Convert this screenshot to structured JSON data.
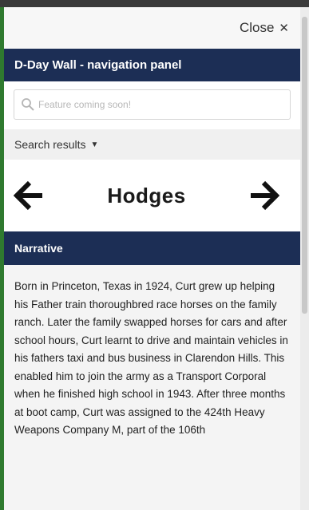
{
  "close": {
    "label": "Close",
    "icon": "close-icon"
  },
  "panel": {
    "title": "D-Day Wall - navigation panel"
  },
  "search": {
    "placeholder": "Feature coming soon!",
    "value": ""
  },
  "results": {
    "label": "Search results"
  },
  "navigation": {
    "name": "Hodges",
    "prev_icon": "arrow-left-icon",
    "next_icon": "arrow-right-icon"
  },
  "narrative": {
    "title": "Narrative",
    "text": "Born in Princeton, Texas in 1924, Curt grew up helping his Father train thoroughbred race horses on the family ranch. Later the family swapped horses for cars and after school hours, Curt learnt to drive and maintain vehicles in his fathers taxi and bus business in Clarendon Hills. This enabled him to join the army as a Transport Corporal when he finished high school in 1943. After three months at boot camp, Curt was assigned to the 424th Heavy Weapons Company M, part of the 106th"
  },
  "colors": {
    "header_bg": "#1c2e55",
    "header_text": "#ffffff",
    "body_bg": "#f4f4f4"
  }
}
